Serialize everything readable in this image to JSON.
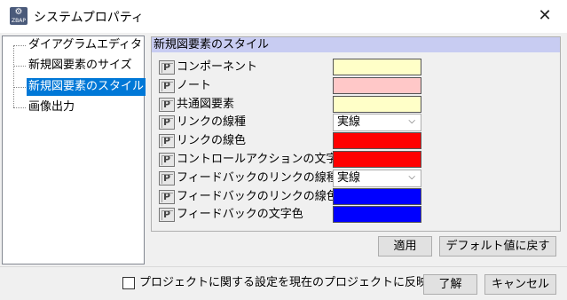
{
  "window": {
    "title": "システムプロパティ",
    "app_icon_text": "ZBAP",
    "close_glyph": "✕"
  },
  "tree": {
    "items": [
      {
        "label": "ダイアグラムエディタ",
        "selected": false
      },
      {
        "label": "新規図要素のサイズ",
        "selected": false
      },
      {
        "label": "新規図要素のスタイル",
        "selected": true
      },
      {
        "label": "画像出力",
        "selected": false
      }
    ]
  },
  "panel": {
    "header": "新規図要素のスタイル",
    "rows": [
      {
        "label": "コンポーネント",
        "kind": "color",
        "color": "#ffffc8"
      },
      {
        "label": "ノート",
        "kind": "color",
        "color": "#ffc8c8"
      },
      {
        "label": "共通図要素",
        "kind": "color",
        "color": "#ffffc8"
      },
      {
        "label": "リンクの線種",
        "kind": "select",
        "value": "実線"
      },
      {
        "label": "リンクの線色",
        "kind": "color",
        "color": "#ff0000"
      },
      {
        "label": "コントロールアクションの文字色",
        "kind": "color",
        "color": "#ff0000"
      },
      {
        "label": "フィードバックのリンクの線種",
        "kind": "select",
        "value": "実線"
      },
      {
        "label": "フィードバックのリンクの線色",
        "kind": "color",
        "color": "#0000ff"
      },
      {
        "label": "フィードバックの文字色",
        "kind": "color",
        "color": "#0000ff"
      }
    ],
    "icon_letter": "P"
  },
  "buttons": {
    "apply": "適用",
    "reset_default": "デフォルト値に戻す",
    "ok": "了解",
    "cancel": "キャンセル"
  },
  "footer": {
    "checkbox_label": "プロジェクトに関する設定を現在のプロジェクトに反映する",
    "checked": false
  }
}
